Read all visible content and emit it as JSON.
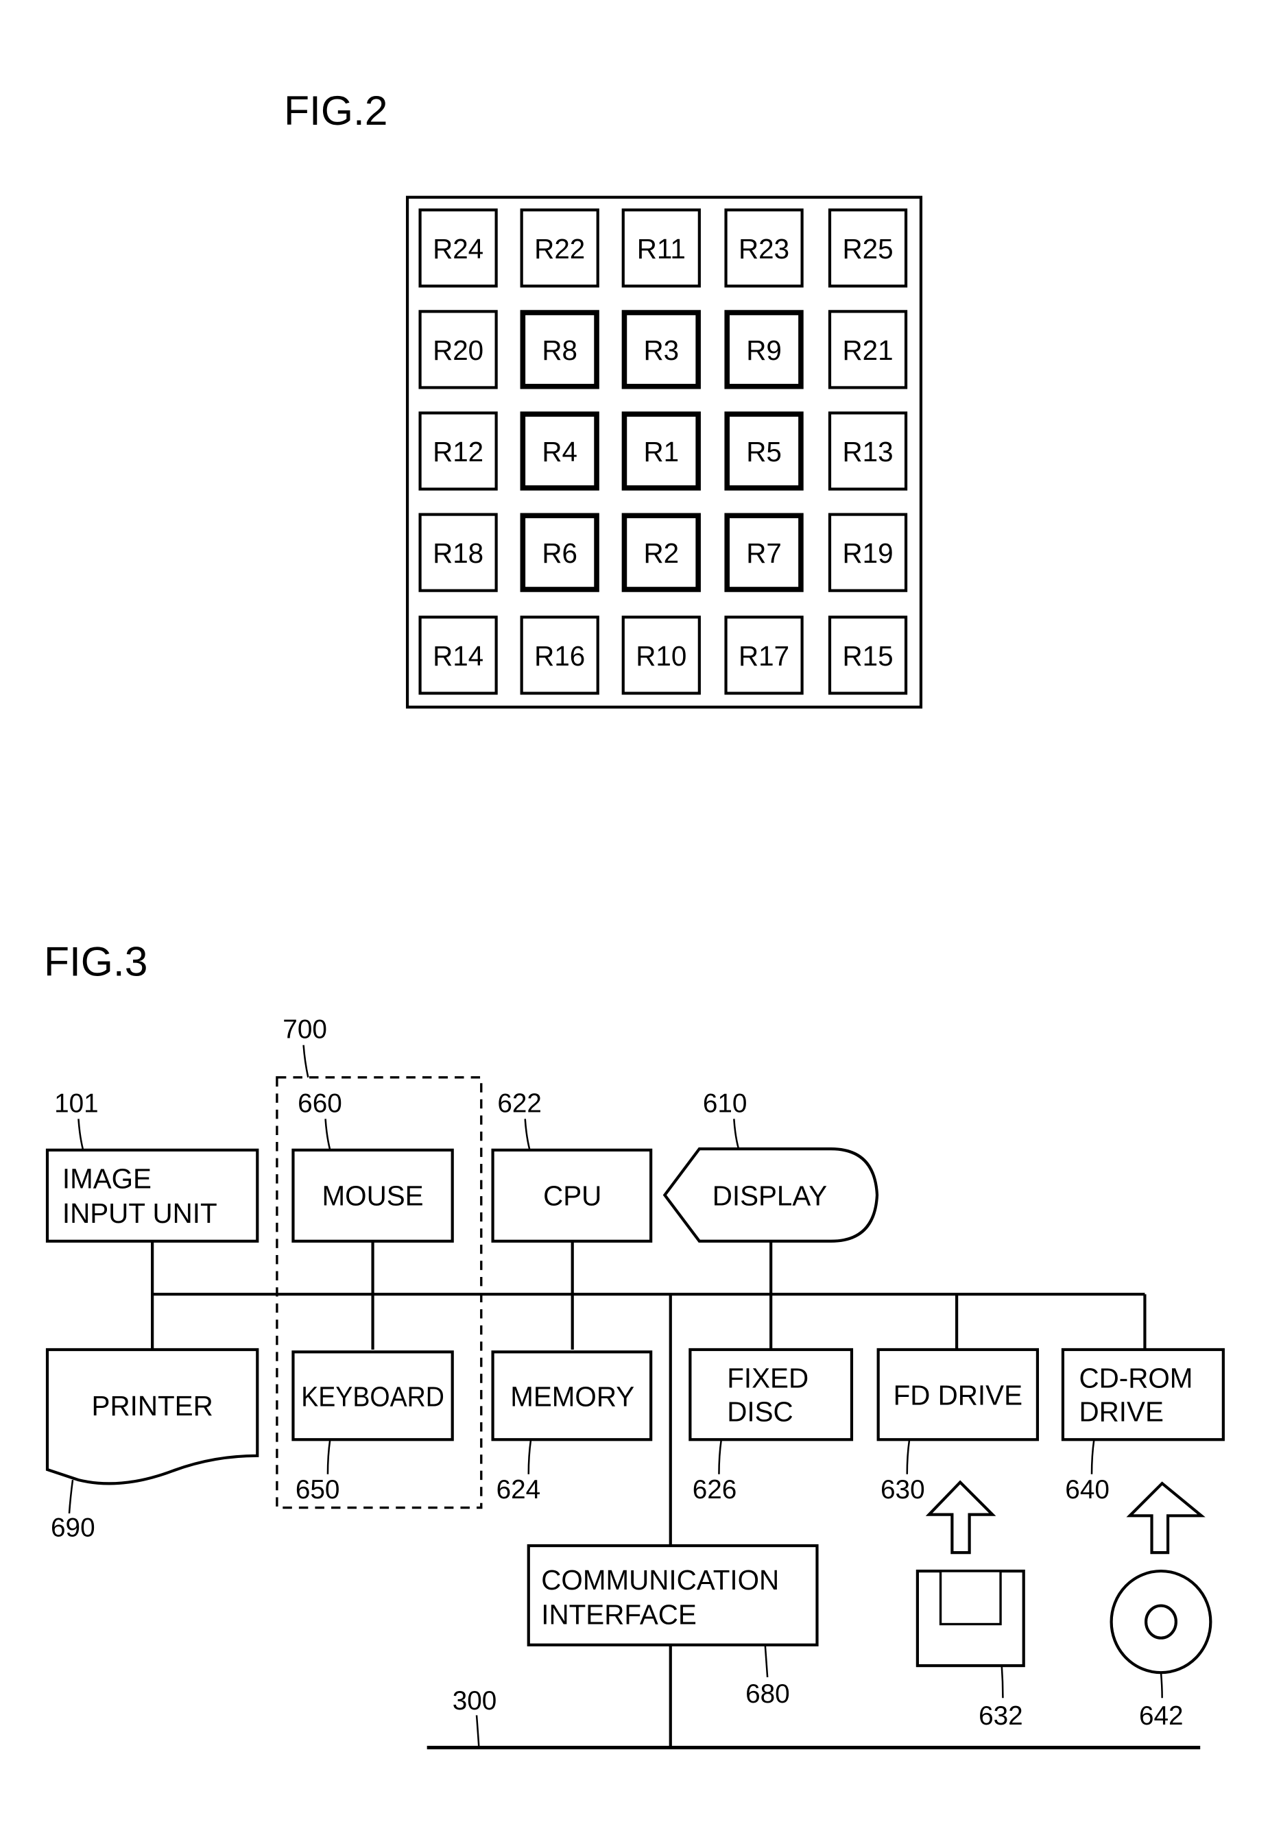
{
  "fig2": {
    "title": "FIG.2",
    "grid": [
      [
        "R24",
        "R22",
        "R11",
        "R23",
        "R25"
      ],
      [
        "R20",
        "R8",
        "R3",
        "R9",
        "R21"
      ],
      [
        "R12",
        "R4",
        "R1",
        "R5",
        "R13"
      ],
      [
        "R18",
        "R6",
        "R2",
        "R7",
        "R19"
      ],
      [
        "R14",
        "R16",
        "R10",
        "R17",
        "R15"
      ]
    ],
    "emphasized_regions": [
      "R8",
      "R3",
      "R9",
      "R4",
      "R1",
      "R5",
      "R6",
      "R2",
      "R7"
    ]
  },
  "fig3": {
    "title": "FIG.3",
    "group_ref": "700",
    "blocks": {
      "image_input": {
        "line1": "IMAGE",
        "line2": "INPUT UNIT",
        "ref": "101"
      },
      "mouse": {
        "label": "MOUSE",
        "ref": "660"
      },
      "cpu": {
        "label": "CPU",
        "ref": "622"
      },
      "display": {
        "label": "DISPLAY",
        "ref": "610"
      },
      "printer": {
        "label": "PRINTER",
        "ref": "690"
      },
      "keyboard": {
        "label": "KEYBOARD",
        "ref": "650"
      },
      "memory": {
        "label": "MEMORY",
        "ref": "624"
      },
      "fixed_disc": {
        "line1": "FIXED",
        "line2": "DISC",
        "ref": "626"
      },
      "fd_drive": {
        "label": "FD DRIVE",
        "ref": "630"
      },
      "cdrom_drive": {
        "line1": "CD-ROM",
        "line2": "DRIVE",
        "ref": "640"
      },
      "comm_interface": {
        "line1": "COMMUNICATION",
        "line2": "INTERFACE",
        "ref": "680"
      },
      "floppy_disk": {
        "ref": "632"
      },
      "cd_rom": {
        "ref": "642"
      },
      "network": {
        "ref": "300"
      }
    }
  }
}
